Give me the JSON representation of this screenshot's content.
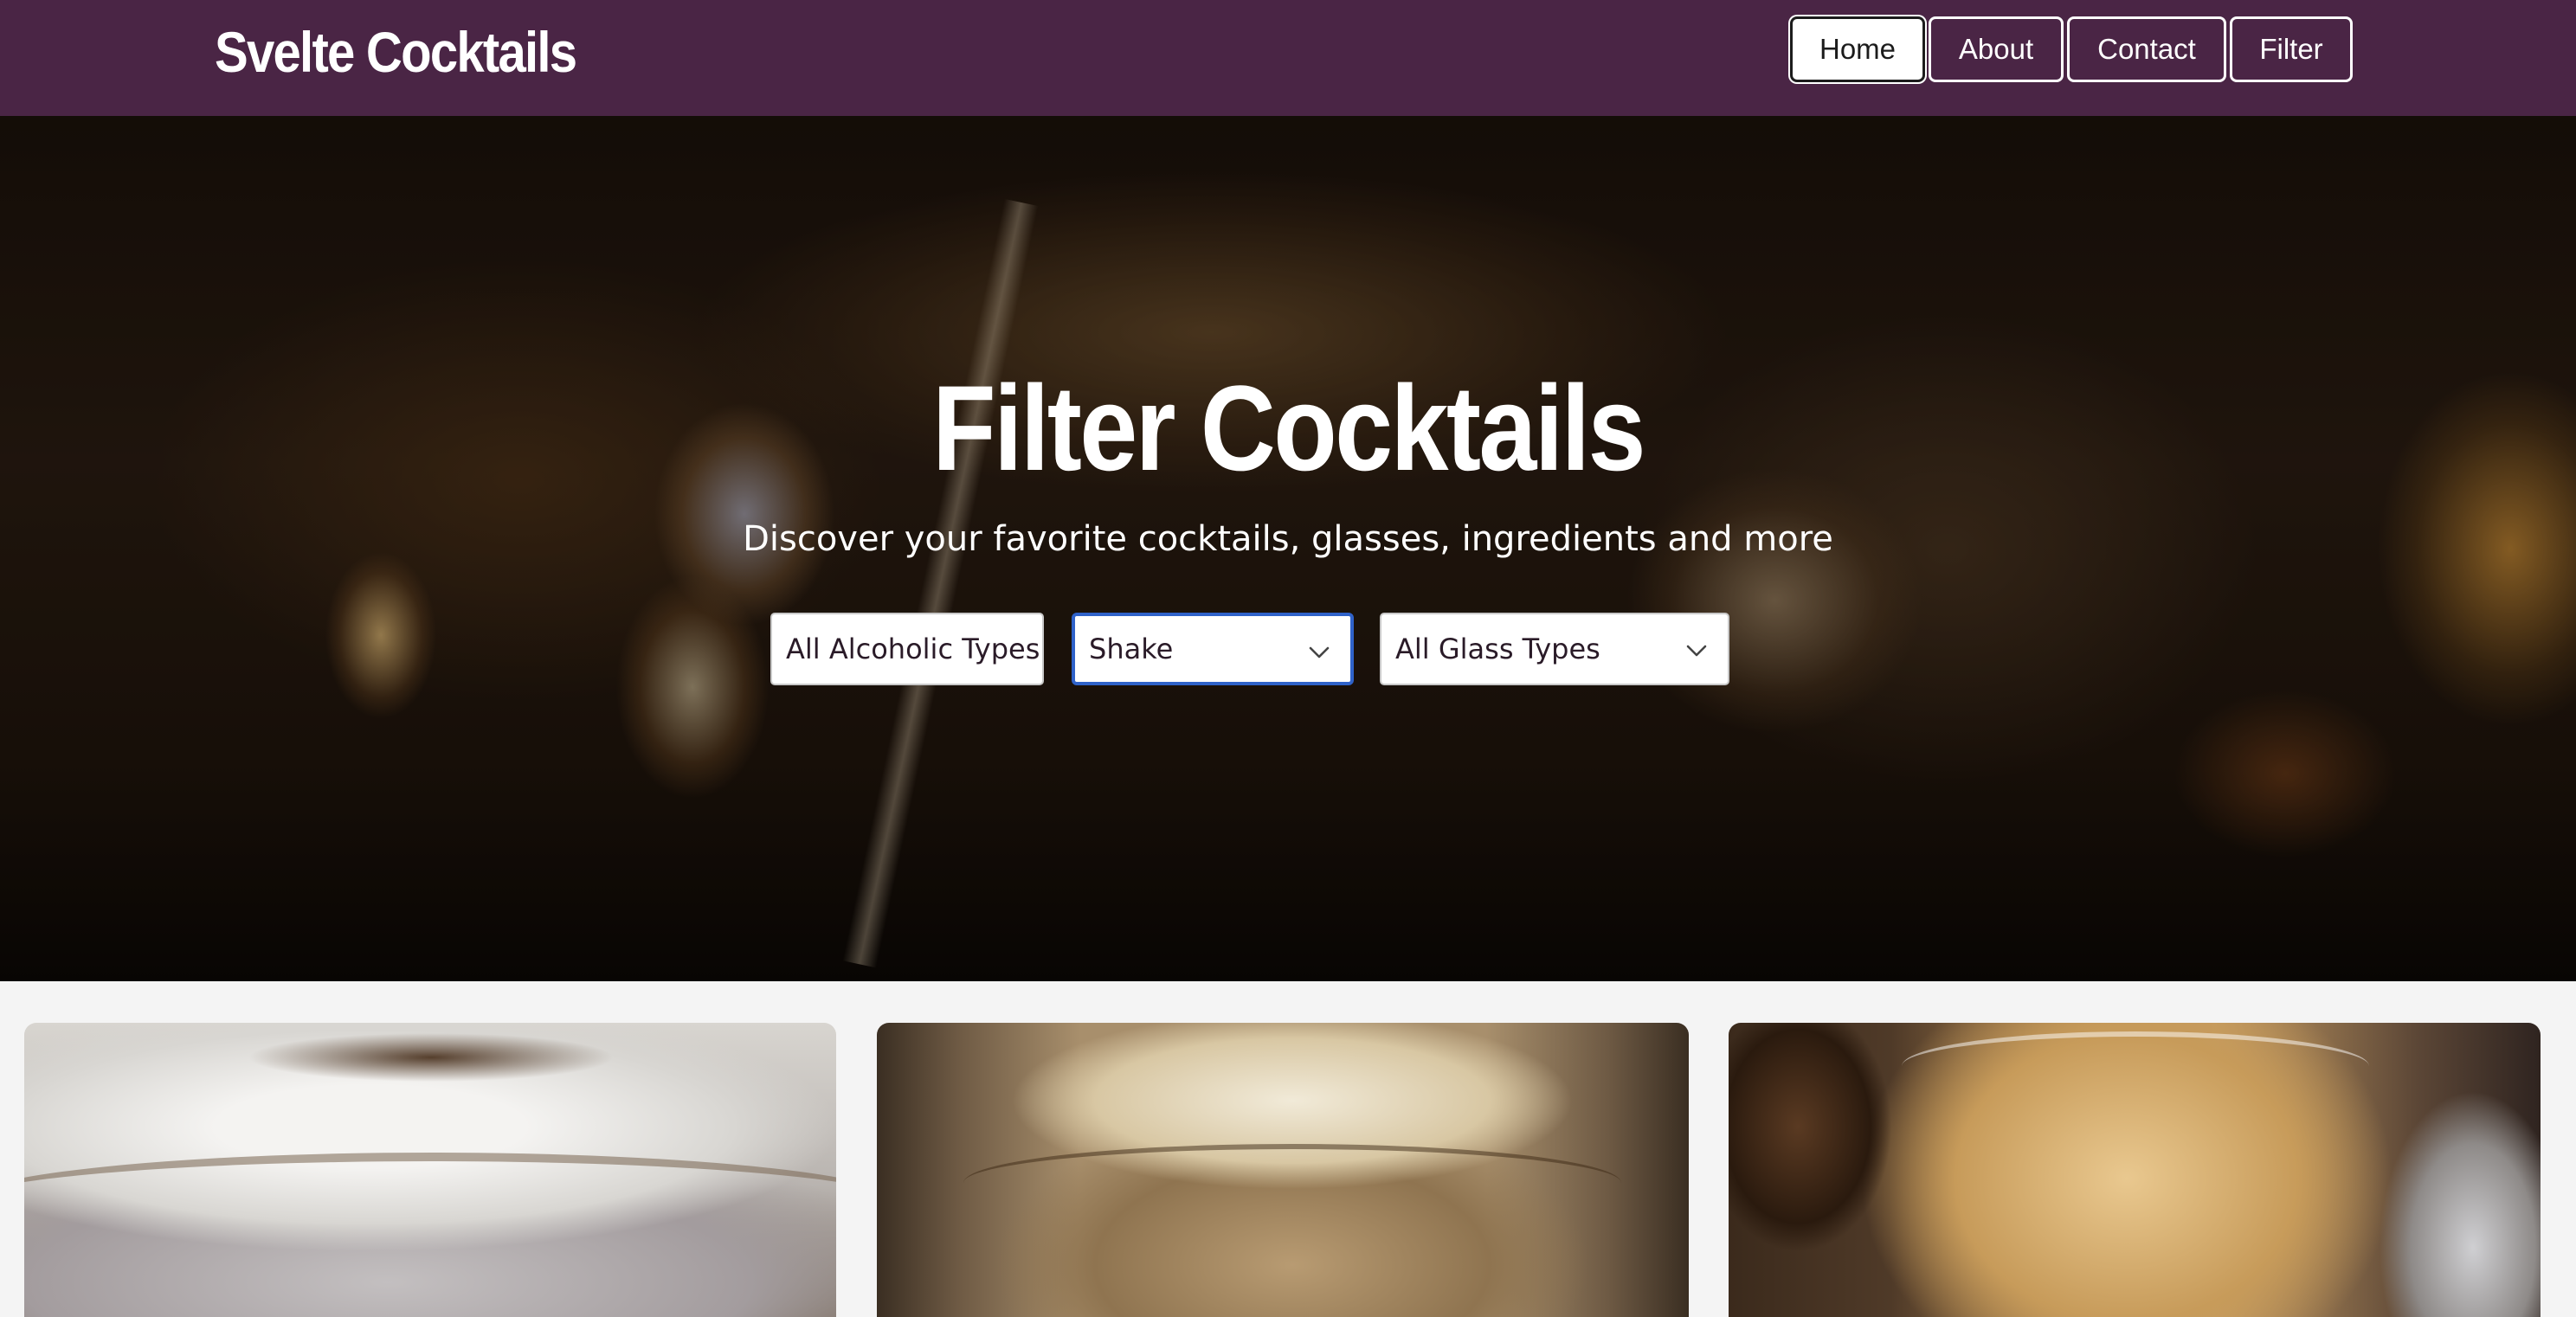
{
  "header": {
    "brand": "Svelte Cocktails",
    "nav": [
      {
        "label": "Home",
        "active": true
      },
      {
        "label": "About",
        "active": false
      },
      {
        "label": "Contact",
        "active": false
      },
      {
        "label": "Filter",
        "active": false
      }
    ],
    "bg_color": "#4a2545"
  },
  "hero": {
    "title": "Filter Cocktails",
    "subtitle": "Discover your favorite cocktails, glasses, ingredients and more",
    "filters": [
      {
        "selected": "All Alcoholic Types",
        "focused": false
      },
      {
        "selected": "Shake",
        "focused": true
      },
      {
        "selected": "All Glass Types",
        "focused": false
      }
    ],
    "focus_color": "#2f62c9"
  },
  "cards": [
    {
      "kind": "cocktail-image"
    },
    {
      "kind": "cocktail-image"
    },
    {
      "kind": "cocktail-image"
    }
  ],
  "icons": {
    "select_arrow": "chevron-down-icon"
  }
}
